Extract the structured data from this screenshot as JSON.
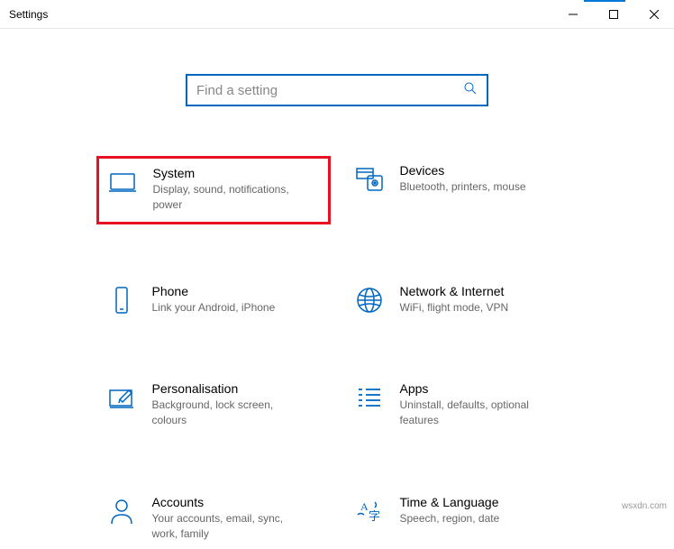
{
  "window": {
    "title": "Settings"
  },
  "search": {
    "placeholder": "Find a setting"
  },
  "tiles": {
    "system": {
      "title": "System",
      "desc": "Display, sound, notifications, power"
    },
    "devices": {
      "title": "Devices",
      "desc": "Bluetooth, printers, mouse"
    },
    "phone": {
      "title": "Phone",
      "desc": "Link your Android, iPhone"
    },
    "network": {
      "title": "Network & Internet",
      "desc": "WiFi, flight mode, VPN"
    },
    "personal": {
      "title": "Personalisation",
      "desc": "Background, lock screen, colours"
    },
    "apps": {
      "title": "Apps",
      "desc": "Uninstall, defaults, optional features"
    },
    "accounts": {
      "title": "Accounts",
      "desc": "Your accounts, email, sync, work, family"
    },
    "timelang": {
      "title": "Time & Language",
      "desc": "Speech, region, date"
    }
  },
  "watermark": "wsxdn.com"
}
